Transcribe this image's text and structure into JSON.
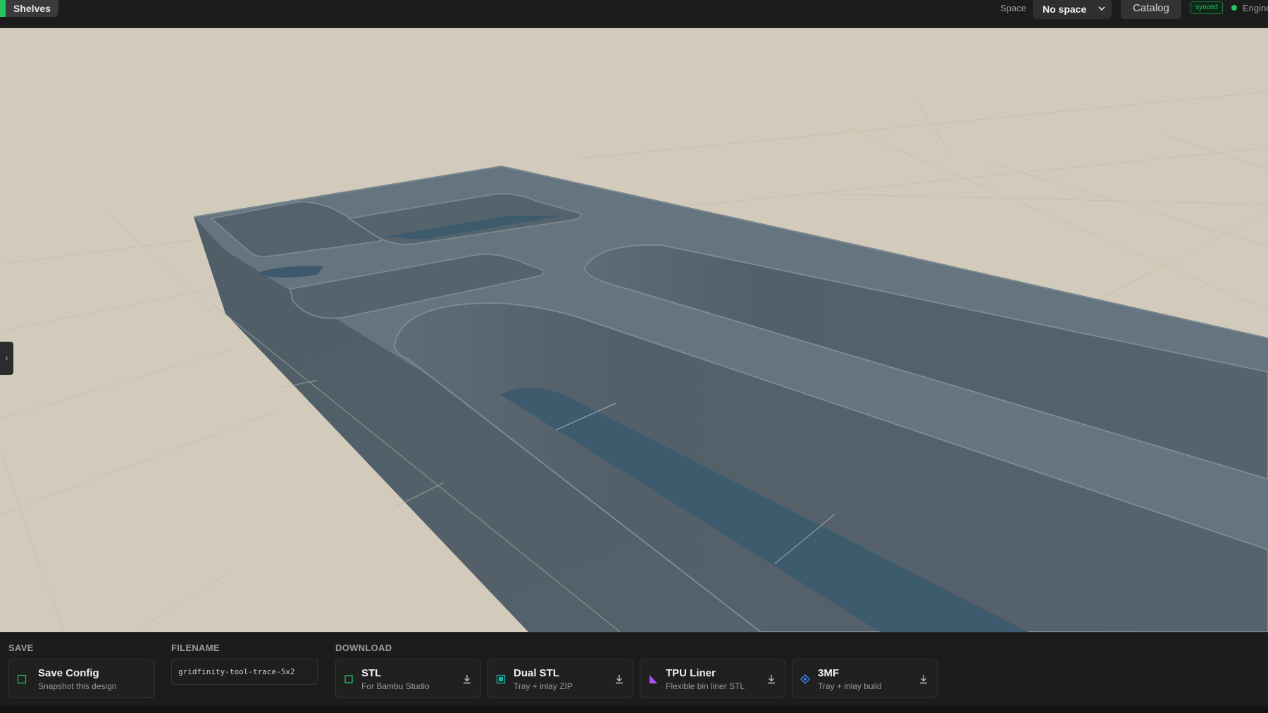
{
  "topbar": {
    "shelves_label": "Shelves",
    "space_label": "Space",
    "space_select": {
      "value": "No space"
    },
    "catalog_label": "Catalog",
    "sync_badge": "synced",
    "engine_label": "Engine",
    "accent_color": "#22c55e"
  },
  "viewport": {
    "toggle_glyph": "‹",
    "model_color": "#5a6872",
    "ground_color": "#d2cbbb"
  },
  "bottom": {
    "save": {
      "section_label": "SAVE",
      "title": "Save Config",
      "subtitle": "Snapshot this design",
      "icon": "square-outline-icon"
    },
    "filename": {
      "section_label": "FILENAME",
      "value": "gridfinity-tool-trace-5x2"
    },
    "download": {
      "section_label": "DOWNLOAD",
      "items": [
        {
          "title": "STL",
          "subtitle": "For Bambu Studio",
          "icon": "green-square-icon",
          "color": "#22c55e"
        },
        {
          "title": "Dual STL",
          "subtitle": "Tray + inlay ZIP",
          "icon": "teal-square-icon",
          "color": "#14b8a6"
        },
        {
          "title": "TPU Liner",
          "subtitle": "Flexible bin liner STL",
          "icon": "purple-triangle-icon",
          "color": "#a855f7"
        },
        {
          "title": "3MF",
          "subtitle": "Tray + inlay build",
          "icon": "blue-diamond-icon",
          "color": "#3b82f6"
        }
      ]
    }
  }
}
